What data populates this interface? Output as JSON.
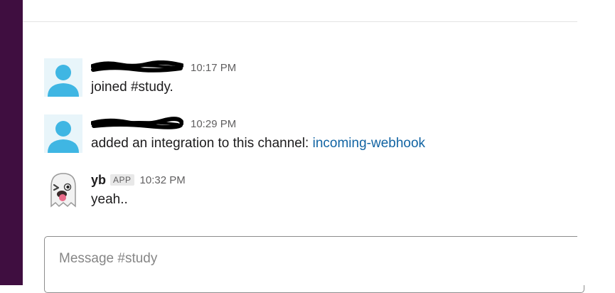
{
  "messages": [
    {
      "user_redacted": true,
      "avatar": "default-user-icon",
      "time": "10:17 PM",
      "text": "joined #study.",
      "link": ""
    },
    {
      "user_redacted": true,
      "avatar": "default-user-icon",
      "time": "10:29 PM",
      "text": "added an integration to this channel: ",
      "link": "incoming-webhook"
    },
    {
      "user": "yb",
      "badge": "APP",
      "avatar": "ghost-emoji-icon",
      "time": "10:32 PM",
      "text": "yeah..",
      "link": ""
    }
  ],
  "composer": {
    "placeholder": "Message #study"
  },
  "colors": {
    "sidebar": "#3f0e40",
    "link": "#1264a3",
    "avatar_default": "#3fb6e3"
  }
}
